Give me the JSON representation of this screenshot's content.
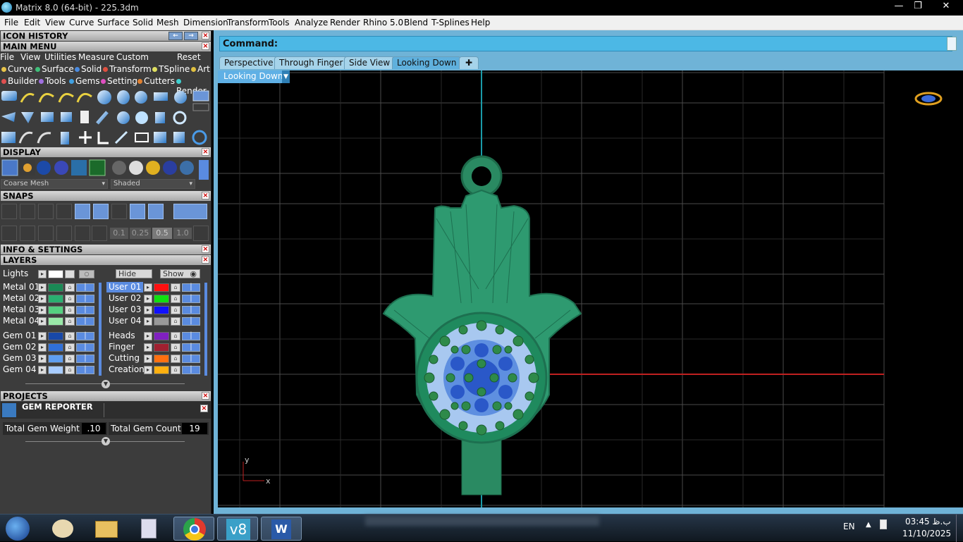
{
  "window": {
    "title": "Matrix 8.0 (64-bit) - 225.3dm"
  },
  "menubar": [
    "File",
    "Edit",
    "View",
    "Curve",
    "Surface",
    "Solid",
    "Mesh",
    "Dimension",
    "Transform",
    "Tools",
    "Analyze",
    "Render",
    "Rhino 5.0",
    "Blend",
    "T-Splines",
    "Help"
  ],
  "panel": {
    "icon_history": "ICON HISTORY",
    "main_menu": "MAIN MENU",
    "main_menu_row1": [
      "File",
      "View",
      "Utilities",
      "Measure",
      "Custom",
      "Reset"
    ],
    "main_menu_row2": [
      {
        "label": "Curve",
        "color": "#e8c44a"
      },
      {
        "label": "Surface",
        "color": "#3fbf7a"
      },
      {
        "label": "Solid",
        "color": "#4a8be0"
      },
      {
        "label": "Transform",
        "color": "#e05040"
      },
      {
        "label": "TSpline",
        "color": "#e0e060"
      },
      {
        "label": "Art",
        "color": "#e0c040"
      }
    ],
    "main_menu_row3": [
      {
        "label": "Builder",
        "color": "#e05050"
      },
      {
        "label": "Tools",
        "color": "#a070e0"
      },
      {
        "label": "Gems",
        "color": "#40a0e0"
      },
      {
        "label": "Setting",
        "color": "#e050c0"
      },
      {
        "label": "Cutters",
        "color": "#e08030"
      },
      {
        "label": "Render",
        "color": "#40d0d0"
      }
    ],
    "display": "DISPLAY",
    "display_mesh": "Coarse Mesh",
    "display_mode": "Shaded",
    "snaps": "SNAPS",
    "snap_values": [
      "0.1",
      "0.25",
      "0.5",
      "1.0"
    ],
    "info_settings": "INFO & SETTINGS",
    "layers": "LAYERS",
    "lights_label": "Lights",
    "hide_label": "Hide",
    "show_label": "Show",
    "layers_left": [
      {
        "name": "Metal 01",
        "color": "#1a8a55"
      },
      {
        "name": "Metal 02",
        "color": "#2ab070"
      },
      {
        "name": "Metal 03",
        "color": "#55d080"
      },
      {
        "name": "Metal 04",
        "color": "#99e8a8"
      },
      {
        "name": "Gem 01",
        "color": "#1848a8"
      },
      {
        "name": "Gem 02",
        "color": "#3070d8"
      },
      {
        "name": "Gem 03",
        "color": "#5f9ef0"
      },
      {
        "name": "Gem 04",
        "color": "#a8ccff"
      }
    ],
    "layers_right": [
      {
        "name": "User 01",
        "color": "#ff1010"
      },
      {
        "name": "User 02",
        "color": "#10e010"
      },
      {
        "name": "User 03",
        "color": "#1010ff"
      },
      {
        "name": "User 04",
        "color": "#999999"
      },
      {
        "name": "Heads",
        "color": "#8020c0"
      },
      {
        "name": "Finger",
        "color": "#a02030"
      },
      {
        "name": "Cutting",
        "color": "#ff7010"
      },
      {
        "name": "Creation",
        "color": "#ffb010"
      }
    ],
    "projects": "PROJECTS",
    "gem_reporter": "GEM REPORTER",
    "total_gem_weight_label": "Total Gem Weight",
    "total_gem_weight": ".10",
    "total_gem_count_label": "Total Gem Count",
    "total_gem_count": "19"
  },
  "command": {
    "label": "Command:",
    "value": ""
  },
  "tabs": [
    "Perspective",
    "Through Finger",
    "Side View",
    "Looking Down"
  ],
  "active_tab": "Looking Down",
  "viewport_label": "Looking Down",
  "axis": {
    "x": "x",
    "y": "y"
  },
  "tray": {
    "lang": "EN",
    "time": "03:45 ب.ظ",
    "date": "11/10/2025"
  }
}
